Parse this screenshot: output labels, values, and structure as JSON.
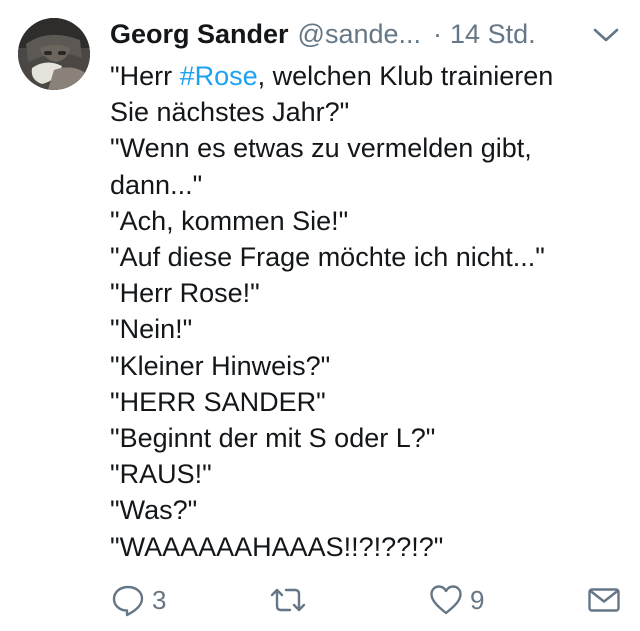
{
  "author": {
    "name": "Georg Sander",
    "handle": "@sande...",
    "separator": "·",
    "time": "14 Std."
  },
  "tweet": {
    "line1_prefix": "\"Herr ",
    "line1_hashtag": "#Rose",
    "line1_suffix": ", welchen Klub trainieren",
    "lines": [
      "Sie nächstes Jahr?\"",
      "\"Wenn es etwas zu vermelden gibt,",
      "dann...\"",
      "\"Ach, kommen Sie!\"",
      "\"Auf diese Frage möchte ich nicht...\"",
      "\"Herr Rose!\"",
      "\"Nein!\"",
      "\"Kleiner Hinweis?\"",
      "\"HERR SANDER\"",
      "\"Beginnt der mit S oder L?\"",
      "\"RAUS!\"",
      "\"Was?\"",
      "\"WAAAAAAHAAAS!!?!??!?\""
    ]
  },
  "actions": {
    "reply_count": "3",
    "retweet_count": "",
    "like_count": "9"
  },
  "icons": {
    "reply": "reply-icon",
    "retweet": "retweet-icon",
    "like": "heart-icon",
    "dm": "envelope-icon",
    "menu": "chevron-down-icon"
  },
  "colors": {
    "text": "#14171a",
    "secondary": "#657786",
    "hashtag": "#1da1f2"
  }
}
